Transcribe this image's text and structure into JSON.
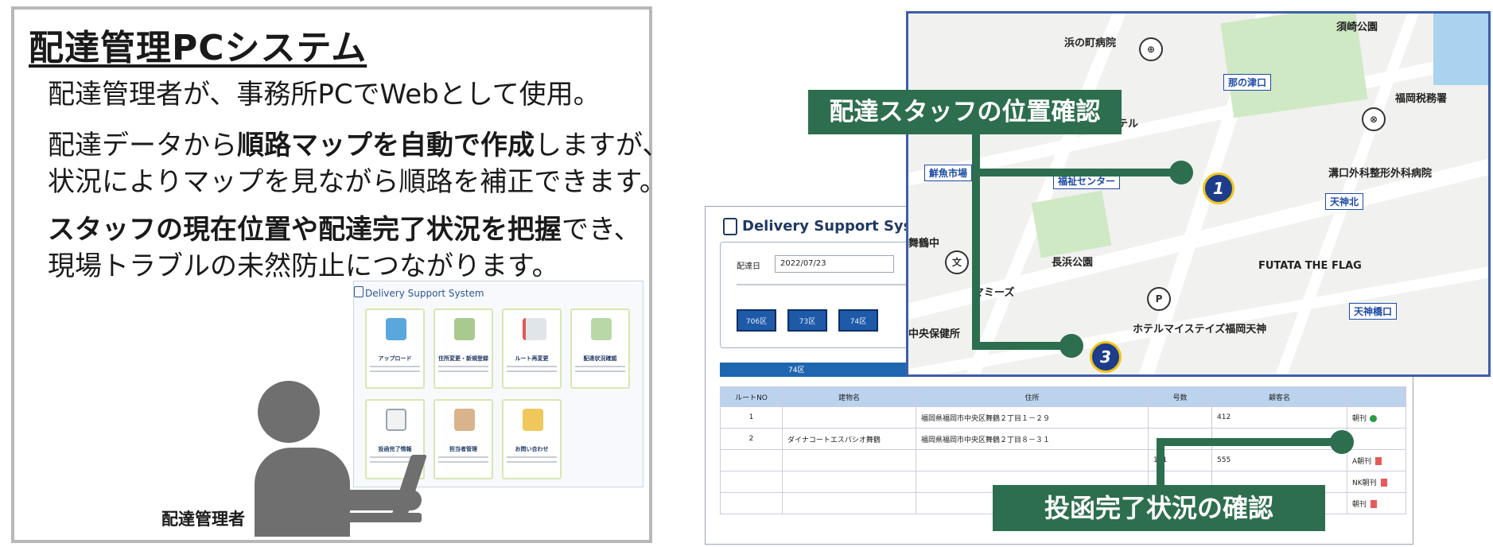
{
  "left": {
    "title": "配達管理PCシステム",
    "para1": "配達管理者が、事務所PCでWebとして使用。",
    "para2_line1_pre": "配達データから",
    "para2_line1_bold": "順路マップを自動で作成",
    "para2_line1_post": "しますが、",
    "para2_line2": "状況によりマップを見ながら順路を補正できます。",
    "para3_line1_bold": "スタッフの現在位置や配達完了状況を把握",
    "para3_line1_post": "でき、",
    "para3_line2": "現場トラブルの未然防止につながります。",
    "person_label": "配達管理者",
    "mini_app": {
      "title": "Delivery Support System",
      "tiles": [
        "アップロード",
        "住所変更・新規登録",
        "ルート再変更",
        "配達状況確認",
        "投函完了情報",
        "担当者管理",
        "お問い合わせ"
      ]
    }
  },
  "app": {
    "title": "Delivery Support System",
    "date_label": "配達日",
    "date_value": "2022/07/23",
    "route_buttons": [
      "706区",
      "73区",
      "74区"
    ],
    "selected_route": "74区",
    "table": {
      "headers": [
        "ルートNO",
        "建物名",
        "住所",
        "号数",
        "顧客名",
        ""
      ],
      "rows": [
        [
          "1",
          "",
          "福岡県福岡市中央区舞鶴２丁目１－２９",
          "",
          "412",
          "朝刊"
        ],
        [
          "2",
          "ダイナコートエスパシオ舞鶴",
          "福岡県福岡市中央区舞鶴２丁目８－３１",
          "",
          "",
          ""
        ],
        [
          "",
          "",
          "",
          "101",
          "555",
          "A朝刊"
        ],
        [
          "",
          "",
          "",
          "",
          "",
          "NK朝刊"
        ],
        [
          "",
          "",
          "",
          "",
          "",
          "朝刊"
        ]
      ]
    }
  },
  "map": {
    "labels": [
      "浜の町病院",
      "須崎公園",
      "那の津口",
      "福岡税務署",
      "ホテル",
      "鮮魚市場",
      "福祉センター",
      "溝口外科整形外科病院",
      "天神北",
      "舞鶴中",
      "長浜公園",
      "マミーズ",
      "FUTATA THE FLAG",
      "天神橋口",
      "ホテルマイステイズ福岡天神",
      "中央保健所"
    ],
    "staff_markers": [
      "1",
      "3"
    ]
  },
  "callouts": {
    "staff_position": "配達スタッフの位置確認",
    "delivery_status": "投函完了状況の確認"
  }
}
